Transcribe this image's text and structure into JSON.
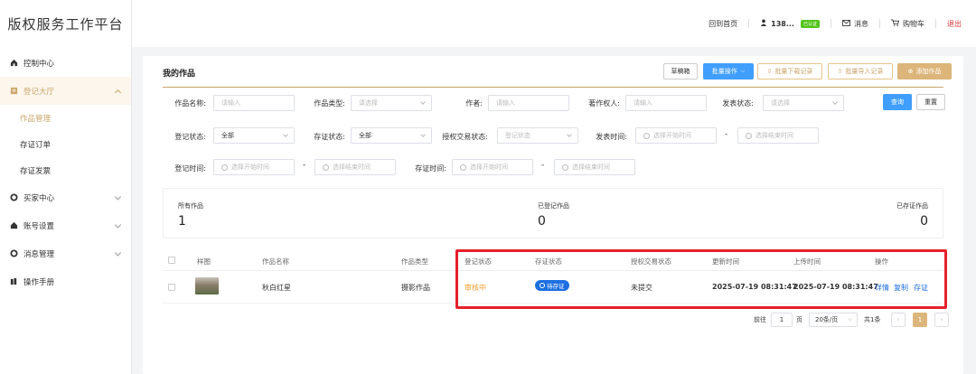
{
  "brand": "版权服务工作平台",
  "header": {
    "home": "回到首页",
    "user": "138...",
    "user_badge": "已认证",
    "messages": "消息",
    "cart": "购物车",
    "logout": "退出"
  },
  "sidebar": {
    "control": "控制中心",
    "register_hall": "登记大厅",
    "works_manage": "作品管理",
    "evidence_orders": "存证订单",
    "evidence_invoice": "存证发票",
    "buyer_center": "买家中心",
    "account_settings": "账号设置",
    "message_manage": "消息管理",
    "manual": "操作手册"
  },
  "card": {
    "title": "我的作品",
    "btn_drafts": "草稿箱",
    "btn_batch": "批量操作",
    "btn_batch_download": "批量下载记录",
    "btn_batch_import": "批量导入记录",
    "btn_add": "添加作品"
  },
  "filters": {
    "work_name_label": "作品名称:",
    "work_name_ph": "请输入",
    "work_type_label": "作品类型:",
    "work_type_ph": "请选择",
    "author_label": "作者:",
    "author_ph": "请输入",
    "copyright_label": "著作权人:",
    "copyright_ph": "请输入",
    "publish_status_label": "发表状态:",
    "publish_status_ph": "请选择",
    "reg_status_label": "登记状态:",
    "reg_status_val": "全部",
    "evi_status_label": "存证状态:",
    "evi_status_val": "全部",
    "trade_status_label": "授权交易状态:",
    "trade_status_ph": "登记状态",
    "publish_time_label": "发表时间:",
    "start_ph": "选择开始时间",
    "end_ph": "选择结束时间",
    "reg_time_label": "登记时间:",
    "evi_time_label": "存证时间:",
    "dash": "-",
    "query": "查询",
    "reset": "重置"
  },
  "stats": [
    {
      "label": "所有作品",
      "value": "1"
    },
    {
      "label": "已登记作品",
      "value": "0"
    },
    {
      "label": "已存证作品",
      "value": "0"
    }
  ],
  "table": {
    "headers": [
      "样图",
      "作品名称",
      "作品类型",
      "登记状态",
      "存证状态",
      "授权交易状态",
      "更新时间",
      "上传时间",
      "操作"
    ],
    "row": {
      "name": "秋白红星",
      "type": "摄影作品",
      "reg_status": "审核中",
      "evi_status": "待存证",
      "trade_status": "未提交",
      "updated": "2025-07-19 08:31:47",
      "uploaded": "2025-07-19 08:31:47",
      "act_detail": "详情",
      "act_copy": "复制",
      "act_evidence": "存证"
    }
  },
  "pager": {
    "goto": "前往",
    "page": "1",
    "page_unit": "页",
    "size": "20条/页",
    "total": "共1条",
    "current": "1"
  },
  "colors": {
    "accent": "#c9a56a",
    "primary": "#409eff",
    "highlight": "#e5202a"
  }
}
